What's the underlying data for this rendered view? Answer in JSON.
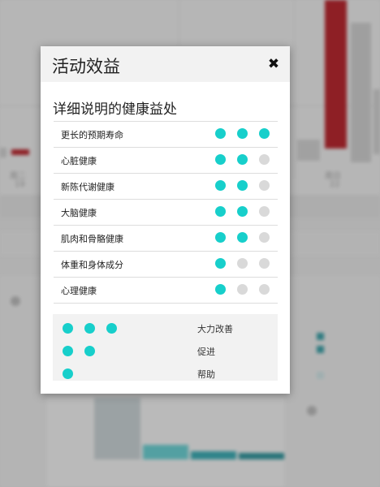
{
  "modal": {
    "title": "活动效益",
    "close_glyph": "✖",
    "subtitle": "详细说明的健康益处",
    "rows": [
      {
        "label": "更长的预期寿命",
        "level": 3
      },
      {
        "label": "心脏健康",
        "level": 2
      },
      {
        "label": "新陈代谢健康",
        "level": 2
      },
      {
        "label": "大脑健康",
        "level": 2
      },
      {
        "label": "肌肉和骨骼健康",
        "level": 2
      },
      {
        "label": "体重和身体成分",
        "level": 1
      },
      {
        "label": "心理健康",
        "level": 1
      }
    ],
    "max_level": 3,
    "legend": [
      {
        "level": 3,
        "label": "大力改善"
      },
      {
        "level": 2,
        "label": "促进"
      },
      {
        "level": 1,
        "label": "帮助"
      }
    ]
  },
  "colors": {
    "dot_on": "#17cfcb",
    "dot_off": "#d9d9d9",
    "bar_red": "#b5121b",
    "bar_gray": "#cfcfcf"
  },
  "background": {
    "ticks": [
      "周二",
      "周日",
      "19",
      "22"
    ]
  }
}
